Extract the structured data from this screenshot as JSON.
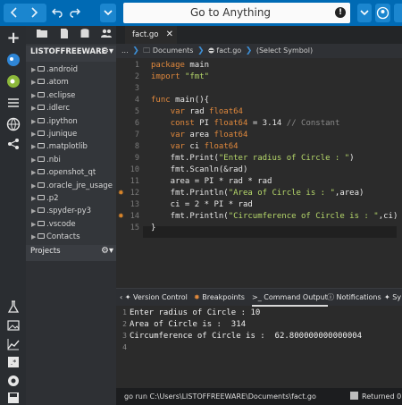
{
  "toolbar": {
    "back_icon": "chevron-left",
    "forward_icon": "chevron-right",
    "undo_icon": "undo",
    "redo_icon": "redo",
    "menu_icon": "chevron-down",
    "search_placeholder": "Go to Anything",
    "info_label": "!"
  },
  "sidebar": {
    "title": "LISTOFFREEWARE",
    "items": [
      {
        "label": ".android"
      },
      {
        "label": ".atom"
      },
      {
        "label": ".eclipse"
      },
      {
        "label": ".idlerc"
      },
      {
        "label": ".ipython"
      },
      {
        "label": ".junique"
      },
      {
        "label": ".matplotlib"
      },
      {
        "label": ".nbi"
      },
      {
        "label": ".openshot_qt"
      },
      {
        "label": ".oracle_jre_usage"
      },
      {
        "label": ".p2"
      },
      {
        "label": ".spyder-py3"
      },
      {
        "label": ".vscode"
      },
      {
        "label": "Contacts"
      }
    ],
    "projects_label": "Projects"
  },
  "editor": {
    "tab_label": "fact.go",
    "breadcrumb": {
      "ellipsis": "...",
      "folder": "Documents",
      "file": "fact.go",
      "symbol": "(Select Symbol)"
    },
    "line_numbers": [
      "1",
      "2",
      "3",
      "4",
      "5",
      "6",
      "7",
      "8",
      "9",
      "10",
      "11",
      "12",
      "13",
      "14",
      "15"
    ],
    "breakpoint_lines": [
      12,
      14
    ]
  },
  "output_panel": {
    "tabs": [
      {
        "label": "Version Control"
      },
      {
        "label": "Breakpoints"
      },
      {
        "label": "Command Output"
      },
      {
        "label": "Notifications"
      },
      {
        "label": "Sy"
      }
    ],
    "line_numbers": [
      "1",
      "2",
      "3",
      "4"
    ],
    "lines": [
      "Enter radius of Circle : 10",
      "Area of Circle is :  314",
      "Circumference of Circle is :  62.800000000000004",
      ""
    ],
    "status_command": "go run C:\\Users\\LISTOFFREEWARE\\Documents\\fact.go",
    "status_result": "Returned 0"
  },
  "colors": {
    "toolbar_bg": "#006ab4",
    "keyword": "#e0883c",
    "string": "#b6d86a"
  }
}
